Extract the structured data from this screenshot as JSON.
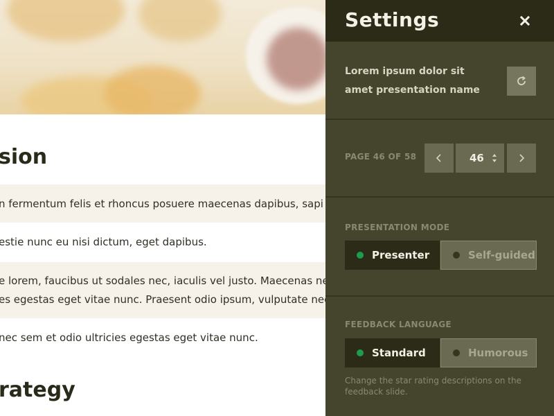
{
  "document": {
    "heading_1": "sion",
    "rows": [
      "n fermentum felis et rhoncus posuere maecenas dapibus, sapi",
      "estie nunc eu nisi dictum, eget dapibus.",
      "e lorem, faucibus ut sodales nec, iaculis vel justo. Maecenas ne",
      "es egestas eget vitae nunc. Praesent odio ipsum, vulputate nec",
      "nec sem et odio ultricies egestas eget vitae nunc."
    ],
    "heading_2": "rategy"
  },
  "settings": {
    "title": "Settings",
    "close_icon": "close-icon",
    "presentation_name": "Lorem ipsum dolor sit amet presentation name",
    "refresh_icon": "refresh-icon",
    "page": {
      "label": "PAGE 46 OF 58",
      "current": "46",
      "total": 58
    },
    "presentation_mode": {
      "label": "PRESENTATION MODE",
      "options": [
        "Presenter",
        "Self-guided"
      ],
      "selected": "Presenter"
    },
    "feedback_language": {
      "label": "FEEDBACK LANGUAGE",
      "options": [
        "Standard",
        "Humorous"
      ],
      "selected": "Standard",
      "hint": "Change the star rating descriptions on the feedback slide."
    }
  },
  "colors": {
    "panel_bg": "#45452d",
    "panel_header": "#2b2b17",
    "active_dot": "#1e9b4e",
    "button_bg": "#6a6a52"
  }
}
